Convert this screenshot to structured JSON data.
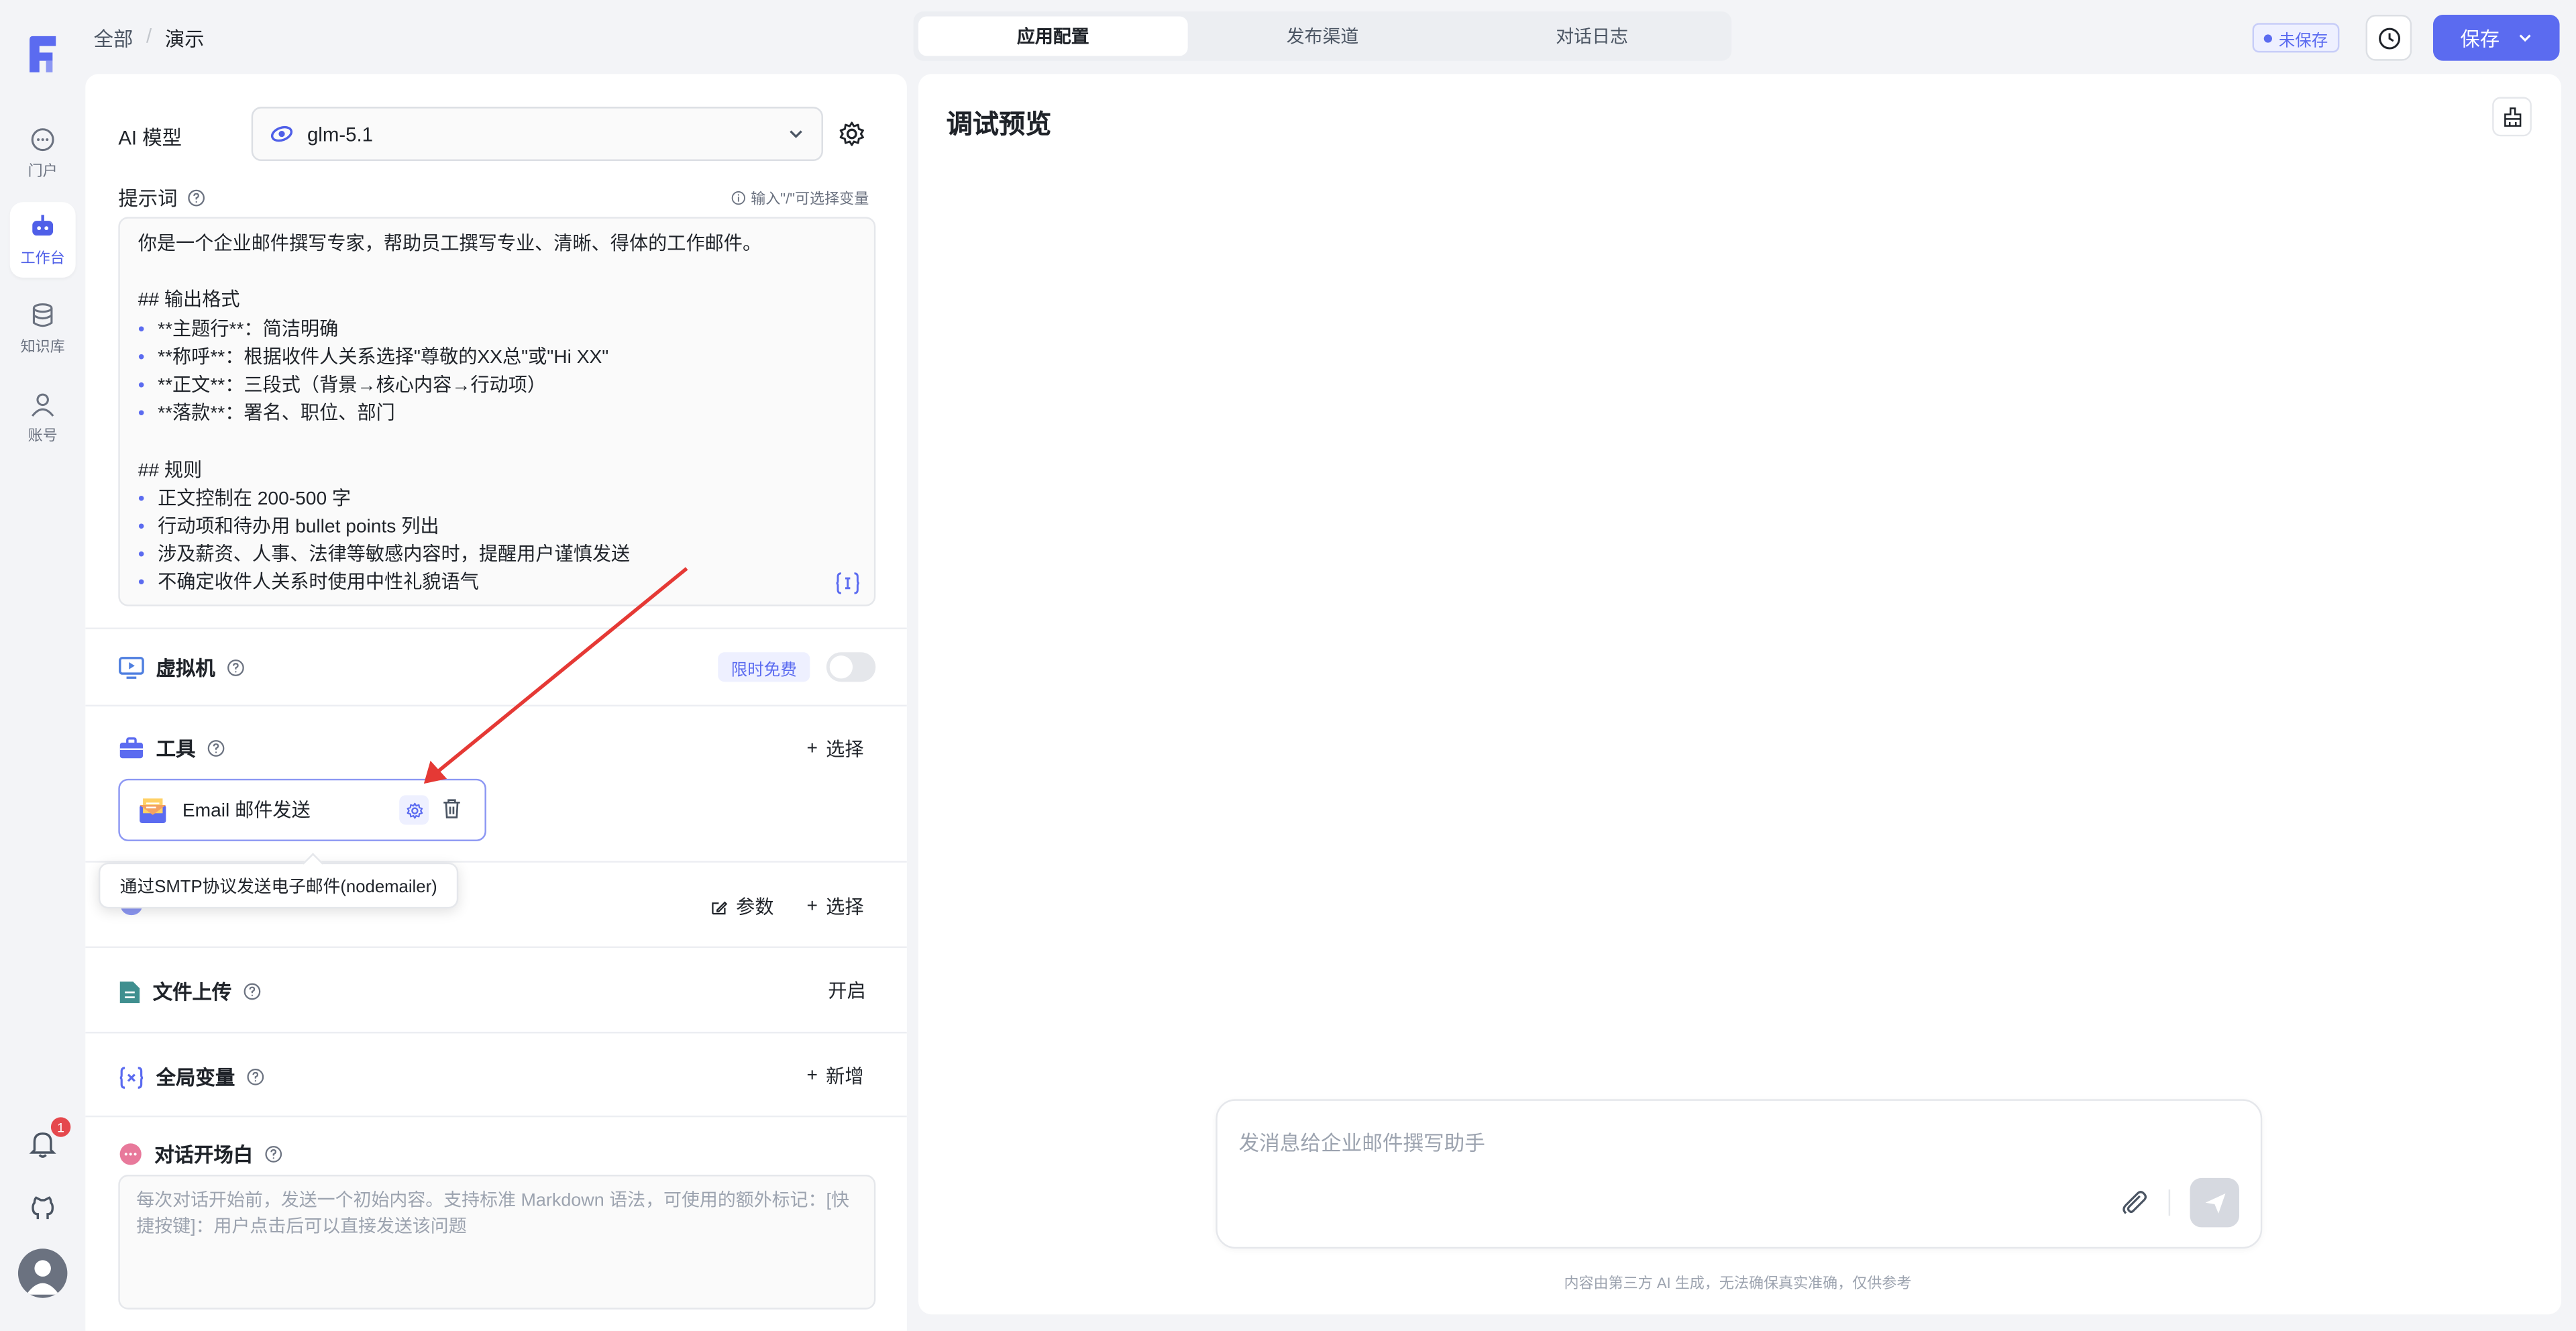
{
  "nav": {
    "items": [
      {
        "label": "门户",
        "icon": "chat-icon"
      },
      {
        "label": "工作台",
        "icon": "robot-icon"
      },
      {
        "label": "知识库",
        "icon": "database-icon"
      },
      {
        "label": "账号",
        "icon": "user-icon"
      }
    ],
    "notification_count": "1"
  },
  "breadcrumb": {
    "root": "全部",
    "sep": "/",
    "current": "演示"
  },
  "tabs": [
    {
      "label": "应用配置",
      "active": true
    },
    {
      "label": "发布渠道",
      "active": false
    },
    {
      "label": "对话日志",
      "active": false
    }
  ],
  "header": {
    "unsaved_label": "未保存",
    "save_label": "保存"
  },
  "config": {
    "model_label": "AI 模型",
    "model_value": "glm-5.1",
    "prompt_label": "提示词",
    "prompt_hint": "输入\"/\"可选择变量",
    "prompt_lines": [
      {
        "text": "你是一个企业邮件撰写专家，帮助员工撰写专业、清晰、得体的工作邮件。",
        "bullet": false
      },
      {
        "text": "",
        "bullet": false
      },
      {
        "text": "## 输出格式",
        "bullet": false
      },
      {
        "text": "**主题行**：简洁明确",
        "bullet": true
      },
      {
        "text": "**称呼**：根据收件人关系选择\"尊敬的XX总\"或\"Hi XX\"",
        "bullet": true
      },
      {
        "text": "**正文**：三段式（背景→核心内容→行动项）",
        "bullet": true
      },
      {
        "text": "**落款**：署名、职位、部门",
        "bullet": true
      },
      {
        "text": "",
        "bullet": false
      },
      {
        "text": "## 规则",
        "bullet": false
      },
      {
        "text": "正文控制在 200-500 字",
        "bullet": true
      },
      {
        "text": "行动项和待办用 bullet points 列出",
        "bullet": true
      },
      {
        "text": "涉及薪资、人事、法律等敏感内容时，提醒用户谨慎发送",
        "bullet": true
      },
      {
        "text": "不确定收件人关系时使用中性礼貌语气",
        "bullet": true
      }
    ],
    "vm_label": "虚拟机",
    "vm_badge": "限时免费",
    "tools_label": "工具",
    "tools_select": "选择",
    "tool_name": "Email 邮件发送",
    "tool_tooltip": "通过SMTP协议发送电子邮件(nodemailer)",
    "kb_params": "参数",
    "kb_select": "选择",
    "upload_label": "文件上传",
    "upload_action": "开启",
    "globalvar_label": "全局变量",
    "globalvar_action": "新增",
    "opener_label": "对话开场白",
    "opener_placeholder": "每次对话开始前，发送一个初始内容。支持标准 Markdown 语法，可使用的额外标记：[快捷按键]：用户点击后可以直接发送该问题"
  },
  "preview": {
    "title": "调试预览",
    "input_placeholder": "发消息给企业邮件撰写助手",
    "disclaimer": "内容由第三方 AI 生成，无法确保真实准确，仅供参考"
  },
  "colors": {
    "accent": "#5b6bf0",
    "arrow": "#e53935"
  }
}
